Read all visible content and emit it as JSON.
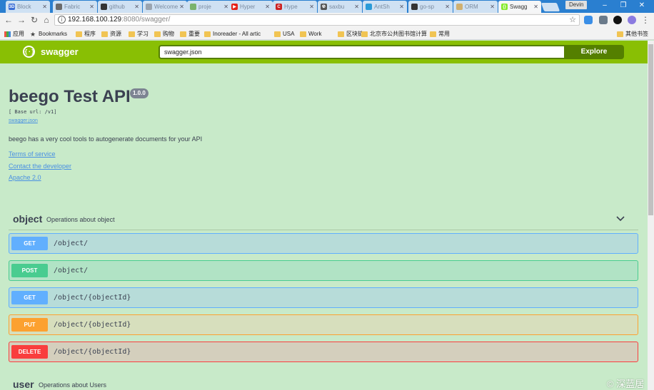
{
  "browser": {
    "tabs": [
      {
        "title": "Block",
        "color": "#3b6fd6",
        "glyph": "3D"
      },
      {
        "title": "Fabric",
        "color": "#6b6b6b",
        "glyph": ""
      },
      {
        "title": "github",
        "color": "#333333",
        "glyph": ""
      },
      {
        "title": "Welcome",
        "color": "#9aa4b0",
        "glyph": ""
      },
      {
        "title": "proje",
        "color": "#7ab36b",
        "glyph": ""
      },
      {
        "title": "Hyper",
        "color": "#e62117",
        "glyph": "▶"
      },
      {
        "title": "Hype",
        "color": "#cc2222",
        "glyph": "C"
      },
      {
        "title": "saxbu",
        "color": "#555555",
        "glyph": "☢"
      },
      {
        "title": "AntSh",
        "color": "#2b9bd8",
        "glyph": ""
      },
      {
        "title": "go-sp",
        "color": "#333333",
        "glyph": ""
      },
      {
        "title": "ORM",
        "color": "#d0b070",
        "glyph": ""
      },
      {
        "title": "Swagg",
        "color": "#85ea2d",
        "glyph": "{}"
      }
    ],
    "profile_name": "Devin",
    "url_host": "192.168.100.129",
    "url_rest": ":8080/swagger/",
    "bookmarks": [
      {
        "label": "应用",
        "icon": "grid"
      },
      {
        "label": "Bookmarks",
        "icon": "star"
      },
      {
        "label": "程序",
        "icon": "folder"
      },
      {
        "label": "资源",
        "icon": "folder"
      },
      {
        "label": "学习",
        "icon": "folder"
      },
      {
        "label": "购物",
        "icon": "folder"
      },
      {
        "label": "重要",
        "icon": "folder"
      },
      {
        "label": "Inoreader - All artic",
        "icon": "folder"
      },
      {
        "label": "USA",
        "icon": "folder"
      },
      {
        "label": "Work",
        "icon": "folder"
      },
      {
        "label": "区块链",
        "icon": "folder"
      },
      {
        "label": "北京市公共图书馆计算",
        "icon": "folder"
      },
      {
        "label": "常用",
        "icon": "folder"
      }
    ],
    "other_bookmarks": "其他书签"
  },
  "swagger": {
    "logo_text": "swagger",
    "spec_input": "swagger.json",
    "explore_label": "Explore"
  },
  "info": {
    "title": "beego Test API",
    "version": "1.0.0",
    "base_url": "[ Base url: /v1]",
    "spec_link": "swagger.json",
    "description": "beego has a very cool tools to autogenerate documents for your API",
    "terms": "Terms of service",
    "contact": "Contact the developer",
    "license": "Apache 2.0"
  },
  "tags": [
    {
      "name": "object",
      "description": "Operations about object"
    },
    {
      "name": "user",
      "description": "Operations about Users"
    }
  ],
  "operations": [
    {
      "method": "GET",
      "path": "/object/"
    },
    {
      "method": "POST",
      "path": "/object/"
    },
    {
      "method": "GET",
      "path": "/object/{objectId}"
    },
    {
      "method": "PUT",
      "path": "/object/{objectId}"
    },
    {
      "method": "DELETE",
      "path": "/object/{objectId}"
    }
  ],
  "watermark": "© 深蓝居"
}
